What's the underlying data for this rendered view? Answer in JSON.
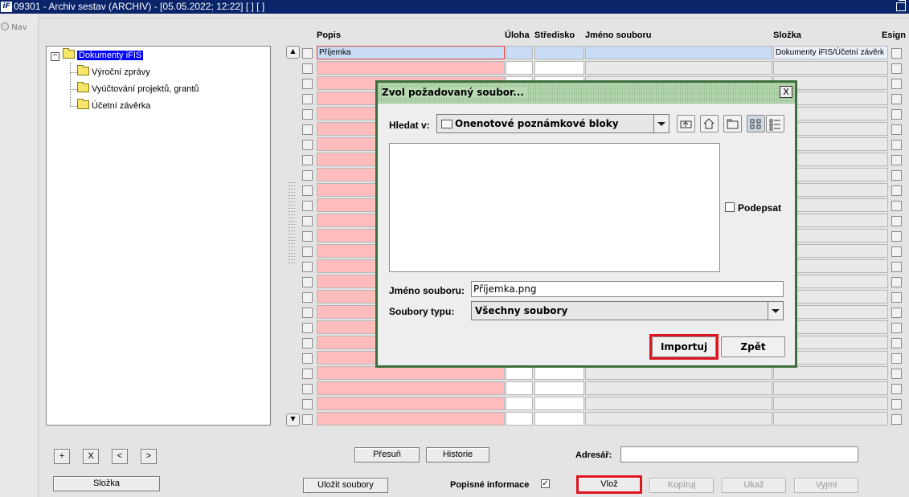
{
  "window": {
    "title": "09301 - Archiv sestav (ARCHIV) - [05.05.2022; 12:22]  [ ]  [ ]",
    "logo": "iF"
  },
  "nav": {
    "label": "Nav"
  },
  "tree": {
    "root": "Dokumenty iFIS",
    "children": [
      "Výroční zprávy",
      "Vyúčtování projektů, grantů",
      "Účetní závěrka"
    ]
  },
  "grid": {
    "headers": {
      "popis": "Popis",
      "uloha": "Úloha",
      "stredisko": "Středisko",
      "jmeno": "Jméno souboru",
      "slozka": "Složka",
      "esign": "Esign"
    },
    "first_row": {
      "popis": "Příjemka",
      "slozka": "Dokumenty iFIS/Účetní závěrk"
    }
  },
  "bottom": {
    "plus": "+",
    "x": "X",
    "prev": "<",
    "next": ">",
    "slozka": "Složka",
    "presun": "Přesuň",
    "historie": "Historie",
    "adresar_label": "Adresář:",
    "adresar_value": "",
    "ulozit": "Uložit soubory",
    "popisne": "Popisné informace",
    "popisne_checked": "✓",
    "vloz": "Vlož",
    "kopiruj": "Kopíruj",
    "ukaz": "Ukaž",
    "vyjmi": "Vyjmi"
  },
  "dialog": {
    "title": "Zvol požadovaný soubor...",
    "close": "X",
    "hledat_label": "Hledat v:",
    "hledat_value": "Onenotové poznámkové bloky",
    "podepsat": "Podepsat",
    "jmeno_label": "Jméno souboru:",
    "jmeno_value": "Příjemka.png",
    "typ_label": "Soubory typu:",
    "typ_value": "Všechny soubory",
    "importuj": "Importuj",
    "zpet": "Zpět"
  },
  "colors": {
    "titlebar": "#0a246a",
    "highlight": "#e0141e",
    "dialog_border": "#3d6e3d",
    "popis_cell": "#ffbcbc"
  }
}
